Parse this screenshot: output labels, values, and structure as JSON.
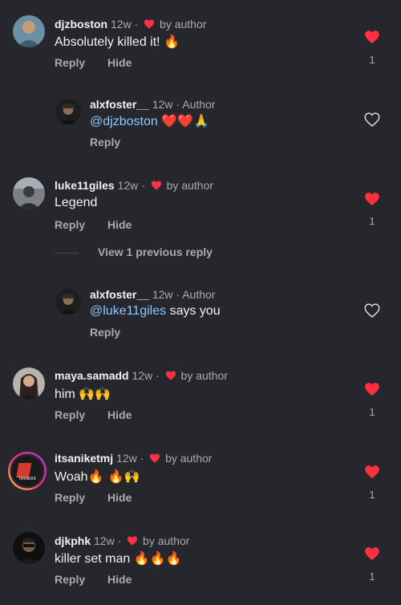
{
  "comments": [
    {
      "user": "djzboston",
      "time": "12w",
      "sep": "·",
      "by_author": "by author",
      "text": "Absolutely killed it!",
      "emoji": "🔥",
      "reply": "Reply",
      "hide": "Hide",
      "likes": "1",
      "liked": true
    },
    {
      "user": "alxfoster__",
      "time": "12w",
      "sep": "·",
      "role": "Author",
      "mention": "@djzboston",
      "emoji": "❤️❤️🙏",
      "reply": "Reply",
      "liked": false
    },
    {
      "user": "luke11giles",
      "time": "12w",
      "sep": "·",
      "by_author": "by author",
      "text": "Legend",
      "reply": "Reply",
      "hide": "Hide",
      "likes": "1",
      "liked": true
    },
    {
      "user": "alxfoster__",
      "time": "12w",
      "sep": "·",
      "role": "Author",
      "mention": "@luke11giles",
      "text": "says you",
      "reply": "Reply",
      "liked": false
    },
    {
      "user": "maya.samadd",
      "time": "12w",
      "sep": "·",
      "by_author": "by author",
      "text": "him",
      "emoji": "🙌🙌",
      "reply": "Reply",
      "hide": "Hide",
      "likes": "1",
      "liked": true
    },
    {
      "user": "itsaniketmj",
      "time": "12w",
      "sep": "·",
      "by_author": "by author",
      "text": "Woah",
      "emoji": "🔥 🔥🙌",
      "reply": "Reply",
      "hide": "Hide",
      "likes": "1",
      "liked": true
    },
    {
      "user": "djkphk",
      "time": "12w",
      "sep": "·",
      "by_author": "by author",
      "text": "killer set man",
      "emoji": "🔥🔥🔥",
      "reply": "Reply",
      "hide": "Hide",
      "likes": "1",
      "liked": true
    }
  ],
  "view_previous": "View 1 previous reply",
  "colors": {
    "heart_red": "#ff3040",
    "mention": "#8fc6ff",
    "background": "#25272c"
  }
}
